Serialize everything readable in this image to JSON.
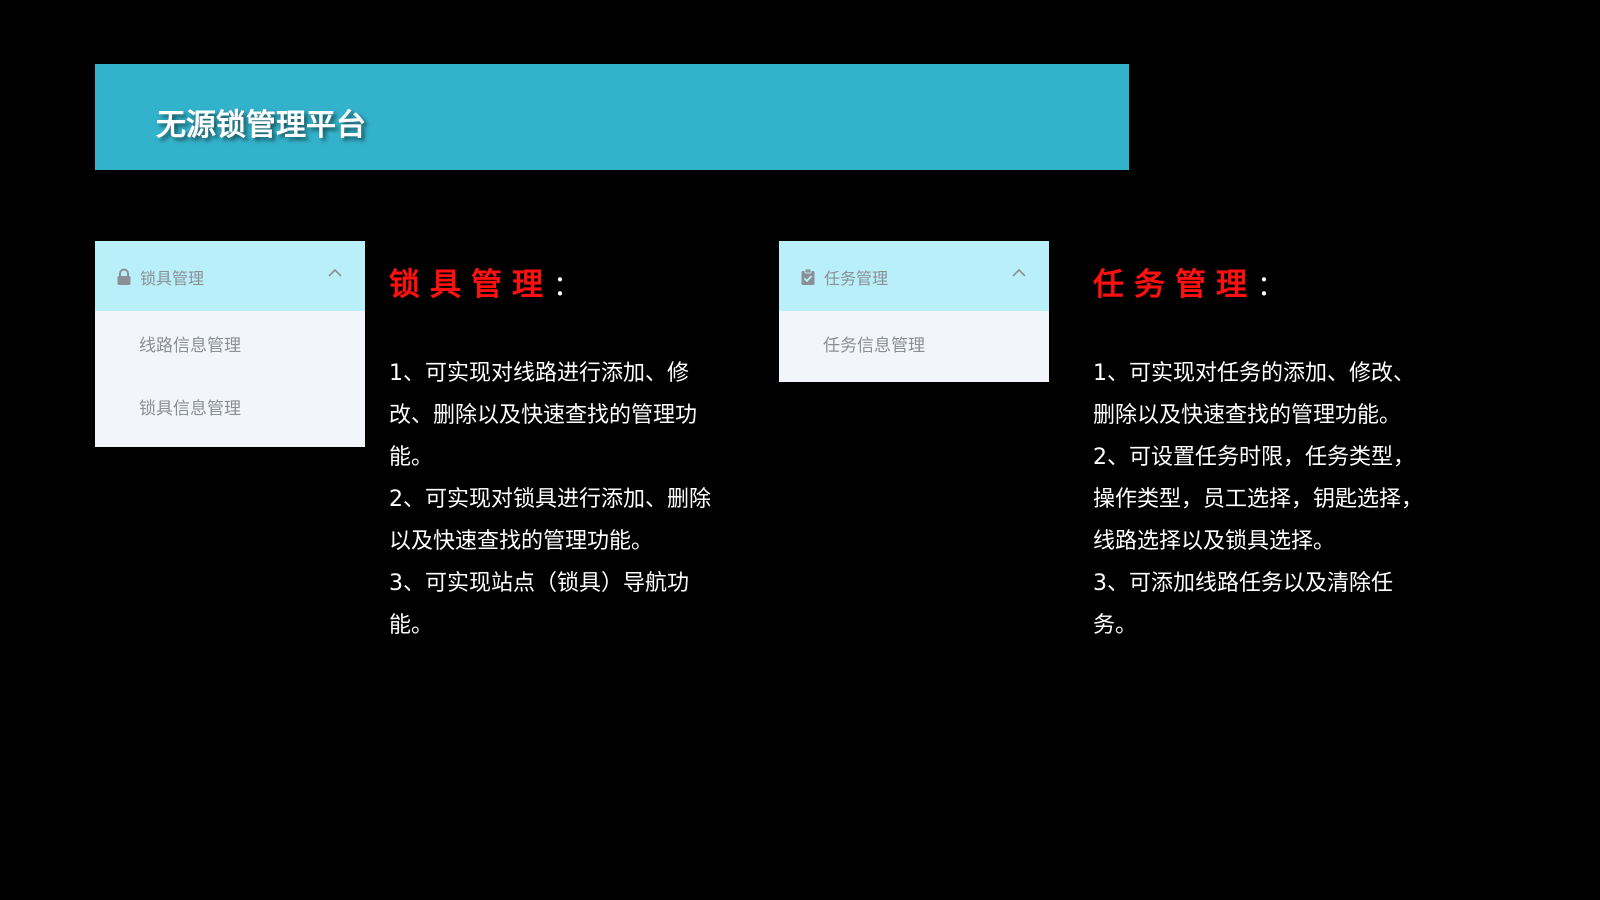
{
  "header": {
    "title": "无源锁管理平台"
  },
  "lock_menu": {
    "icon": "lock-icon",
    "label": "锁具管理",
    "items": [
      "线路信息管理",
      "锁具信息管理"
    ]
  },
  "lock_section": {
    "title": "锁具管理",
    "colon": "：",
    "lines": [
      "1、可实现对线路进行添加、修改、删除以及快速查找的管理功能。",
      "2、可实现对锁具进行添加、删除以及快速查找的管理功能。",
      "3、可实现站点（锁具）导航功能。"
    ]
  },
  "task_menu": {
    "icon": "clipboard-check-icon",
    "label": "任务管理",
    "items": [
      "任务信息管理"
    ]
  },
  "task_section": {
    "title": "任务管理",
    "colon": "：",
    "lines": [
      "1、可实现对任务的添加、修改、删除以及快速查找的管理功能。",
      "2、可设置任务时限，任务类型，操作类型，员工选择，钥匙选择，线路选择以及锁具选择。",
      "3、可添加线路任务以及清除任务。"
    ]
  },
  "colors": {
    "banner": "#33b3cb",
    "menu_header": "#b9eff8",
    "menu_body": "#f2f6fa",
    "title_red": "#ff1010",
    "background": "#000000"
  }
}
